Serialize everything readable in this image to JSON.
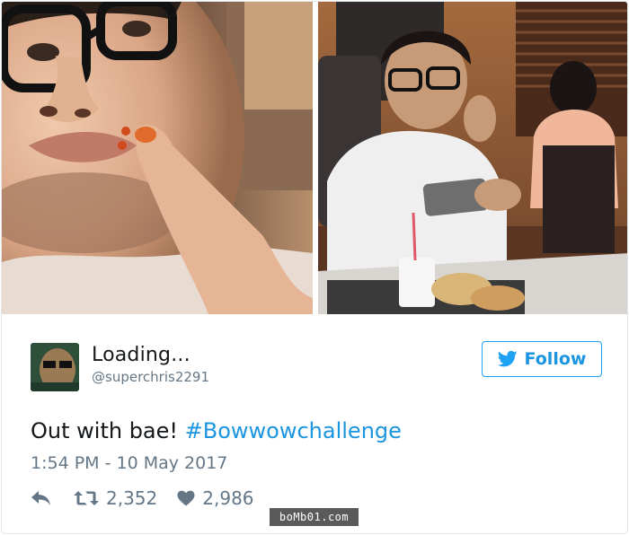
{
  "tweet": {
    "display_name": "Loading...",
    "handle": "@superchris2291",
    "text_plain": "Out with bae! ",
    "hashtag": "#Bowwowchallenge",
    "timestamp": "1:54 PM - 10 May 2017"
  },
  "follow_button": {
    "label": "Follow",
    "icon": "twitter-bird-icon",
    "color": "#1b95e0"
  },
  "actions": {
    "reply_icon": "reply-icon",
    "retweet_icon": "retweet-icon",
    "retweet_count": "2,352",
    "like_icon": "heart-icon",
    "like_count": "2,986"
  },
  "watermark": {
    "text": "boMb01.com"
  },
  "colors": {
    "accent": "#1da1f2",
    "link": "#1b95e0",
    "muted": "#657786",
    "text": "#14171a",
    "border": "#e1e8ed"
  }
}
